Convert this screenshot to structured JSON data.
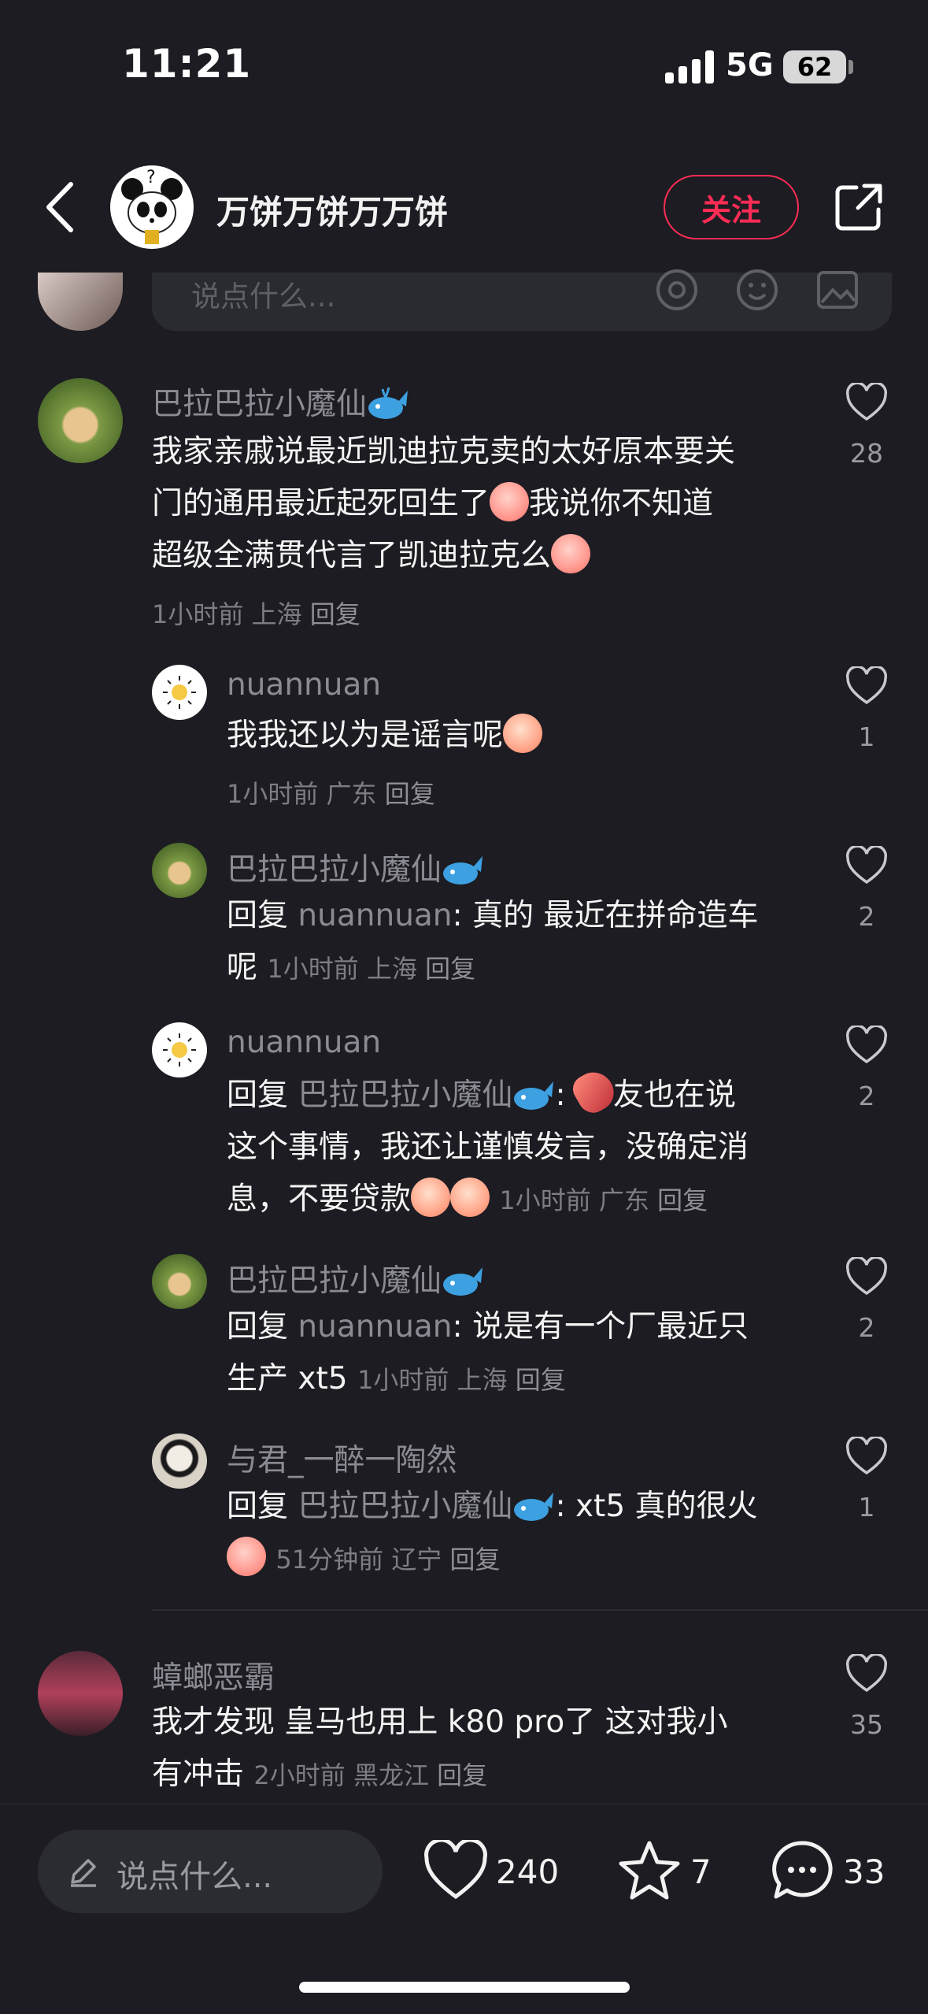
{
  "status": {
    "time": "11:21",
    "network": "5G",
    "battery": "62"
  },
  "header": {
    "author": "万饼万饼万万饼",
    "follow_label": "关注"
  },
  "input_placeholder": "说点什么...",
  "comments": [
    {
      "name": "巴拉巴拉小魔仙",
      "lines": [
        "我家亲戚说最近凯迪拉克卖的太好原本要关",
        "门的通用最近起死回生了",
        "我说你不知道",
        "超级全满贯代言了凯迪拉克么"
      ],
      "time": "1小时前",
      "location": "上海",
      "reply_label": "回复",
      "likes": "28"
    },
    {
      "name": "nuannuan",
      "text": "我我还以为是谣言呢",
      "time": "1小时前",
      "location": "广东",
      "reply_label": "回复",
      "likes": "1"
    },
    {
      "name": "巴拉巴拉小魔仙",
      "prefix": "回复",
      "reply_to": "nuannuan",
      "text1": ": 真的 最近在拼命造车",
      "text2": "呢",
      "time": "1小时前",
      "location": "上海",
      "reply_label": "回复",
      "likes": "2"
    },
    {
      "name": "nuannuan",
      "prefix": "回复",
      "reply_to": "巴拉巴拉小魔仙",
      "text1": ":",
      "text1b": "友也在说",
      "text2": "这个事情，我还让谨慎发言，没确定消",
      "text3": "息，不要贷款",
      "time": "1小时前",
      "location": "广东",
      "reply_label": "回复",
      "likes": "2"
    },
    {
      "name": "巴拉巴拉小魔仙",
      "prefix": "回复",
      "reply_to": "nuannuan",
      "text1": ": 说是有一个厂最近只",
      "text2": "生产 xt5",
      "time": "1小时前",
      "location": "上海",
      "reply_label": "回复",
      "likes": "2"
    },
    {
      "name": "与君_一醉一陶然",
      "prefix": "回复",
      "reply_to": "巴拉巴拉小魔仙",
      "text1": ": xt5 真的很火",
      "time": "51分钟前",
      "location": "辽宁",
      "reply_label": "回复",
      "likes": "1"
    },
    {
      "name": "蟑螂恶霸",
      "text1": "我才发现 皇马也用上 k80 pro了 这对我小",
      "text2": "有冲击",
      "time": "2小时前",
      "location": "黑龙江",
      "reply_label": "回复",
      "likes": "35"
    }
  ],
  "bottom": {
    "placeholder": "说点什么...",
    "likes": "240",
    "stars": "7",
    "comments": "33"
  }
}
